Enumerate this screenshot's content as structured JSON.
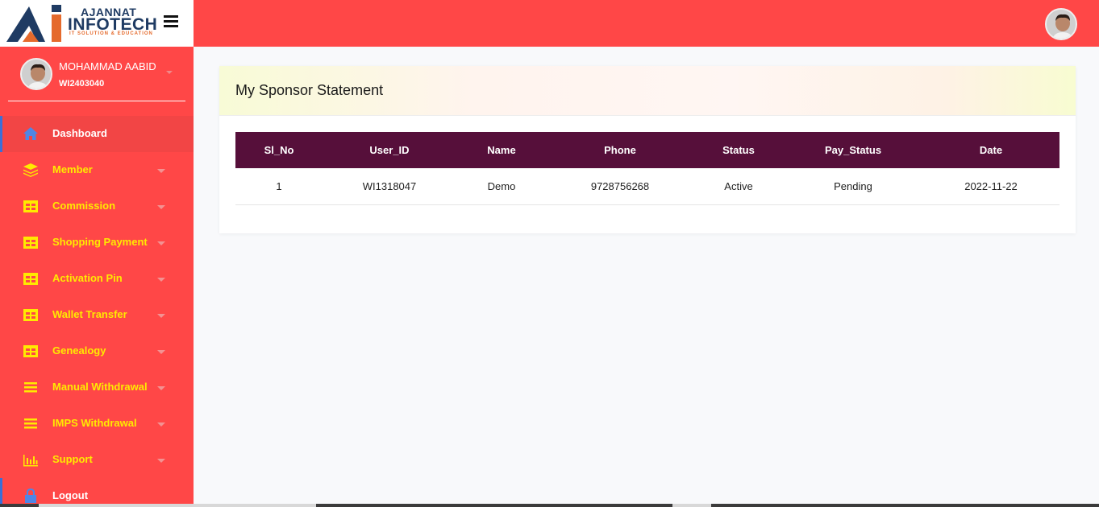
{
  "brand": {
    "line1": "AJANNAT",
    "line2": "INFOTECH",
    "tagline": "IT SOLUTION & EDUCATION"
  },
  "user": {
    "name": "MOHAMMAD AABID",
    "id": "WI2403040"
  },
  "sidebar": {
    "items": [
      {
        "label": "Dashboard",
        "icon": "home-icon"
      },
      {
        "label": "Member",
        "icon": "layers-icon"
      },
      {
        "label": "Commission",
        "icon": "grid-icon"
      },
      {
        "label": "Shopping Payment",
        "icon": "grid-icon"
      },
      {
        "label": "Activation Pin",
        "icon": "grid-icon"
      },
      {
        "label": "Wallet Transfer",
        "icon": "grid-icon"
      },
      {
        "label": "Genealogy",
        "icon": "grid-icon"
      },
      {
        "label": "Manual Withdrawal",
        "icon": "list-icon"
      },
      {
        "label": "IMPS Withdrawal",
        "icon": "list-icon"
      },
      {
        "label": "Support",
        "icon": "bar-chart-icon"
      },
      {
        "label": "Logout",
        "icon": "lock-icon"
      }
    ]
  },
  "main": {
    "title": "My Sponsor Statement",
    "table": {
      "headers": [
        "Sl_No",
        "User_ID",
        "Name",
        "Phone",
        "Status",
        "Pay_Status",
        "Date"
      ],
      "rows": [
        [
          "1",
          "WI1318047",
          "Demo",
          "9728756268",
          "Active",
          "Pending",
          "2022-11-22"
        ]
      ]
    }
  },
  "colors": {
    "accent": "#ff4747",
    "menu_text": "#ffea00",
    "table_header": "#560f3a",
    "status_active": "#2ecc40",
    "status_pending": "#e0222a"
  }
}
